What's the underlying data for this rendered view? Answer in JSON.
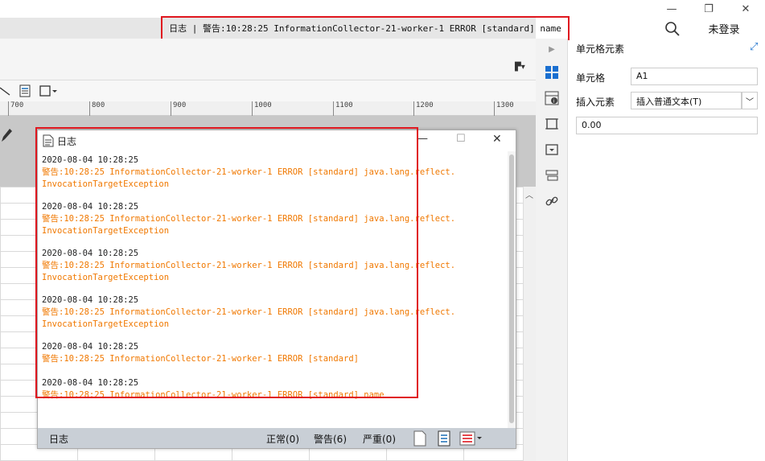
{
  "header": {
    "status_text": "日志 | 警告:10:28:25 InformationCollector-21-worker-1 ERROR [standard] name",
    "login": "未登录",
    "minimize": "—",
    "restore": "❐",
    "close": "✕"
  },
  "ruler": {
    "ticks": [
      "700",
      "800",
      "900",
      "1000",
      "1100",
      "1200",
      "1300"
    ]
  },
  "properties": {
    "title": "单元格元素",
    "cell_label": "单元格",
    "cell_value": "A1",
    "insert_label": "插入元素",
    "insert_value": "插入普通文本(T)",
    "content_value": "0.00"
  },
  "log": {
    "title": "日志",
    "entries": [
      {
        "time": "2020-08-04 10:28:25",
        "line1": "警告:10:28:25 InformationCollector-21-worker-1 ERROR [standard] java.lang.reflect.",
        "line2": "InvocationTargetException"
      },
      {
        "time": "2020-08-04 10:28:25",
        "line1": "警告:10:28:25 InformationCollector-21-worker-1 ERROR [standard] java.lang.reflect.",
        "line2": "InvocationTargetException"
      },
      {
        "time": "2020-08-04 10:28:25",
        "line1": "警告:10:28:25 InformationCollector-21-worker-1 ERROR [standard] java.lang.reflect.",
        "line2": "InvocationTargetException"
      },
      {
        "time": "2020-08-04 10:28:25",
        "line1": "警告:10:28:25 InformationCollector-21-worker-1 ERROR [standard] java.lang.reflect.",
        "line2": "InvocationTargetException"
      },
      {
        "time": "2020-08-04 10:28:25",
        "line1": "警告:10:28:25 InformationCollector-21-worker-1 ERROR [standard]",
        "line2": ""
      },
      {
        "time": "2020-08-04 10:28:25",
        "line1": "警告:10:28:25 InformationCollector-21-worker-1 ERROR [standard] name",
        "line2": ""
      }
    ],
    "footer": {
      "label": "日志",
      "normal": "正常(0)",
      "warning": "警告(6)",
      "severe": "严重(0)"
    }
  },
  "colors": {
    "warning_text": "#f07800",
    "highlight_border": "#e0171f",
    "accent_blue": "#2a7ad0"
  },
  "icons": {
    "search": "search-icon",
    "doc": "document-icon",
    "pin": "pin-icon"
  }
}
